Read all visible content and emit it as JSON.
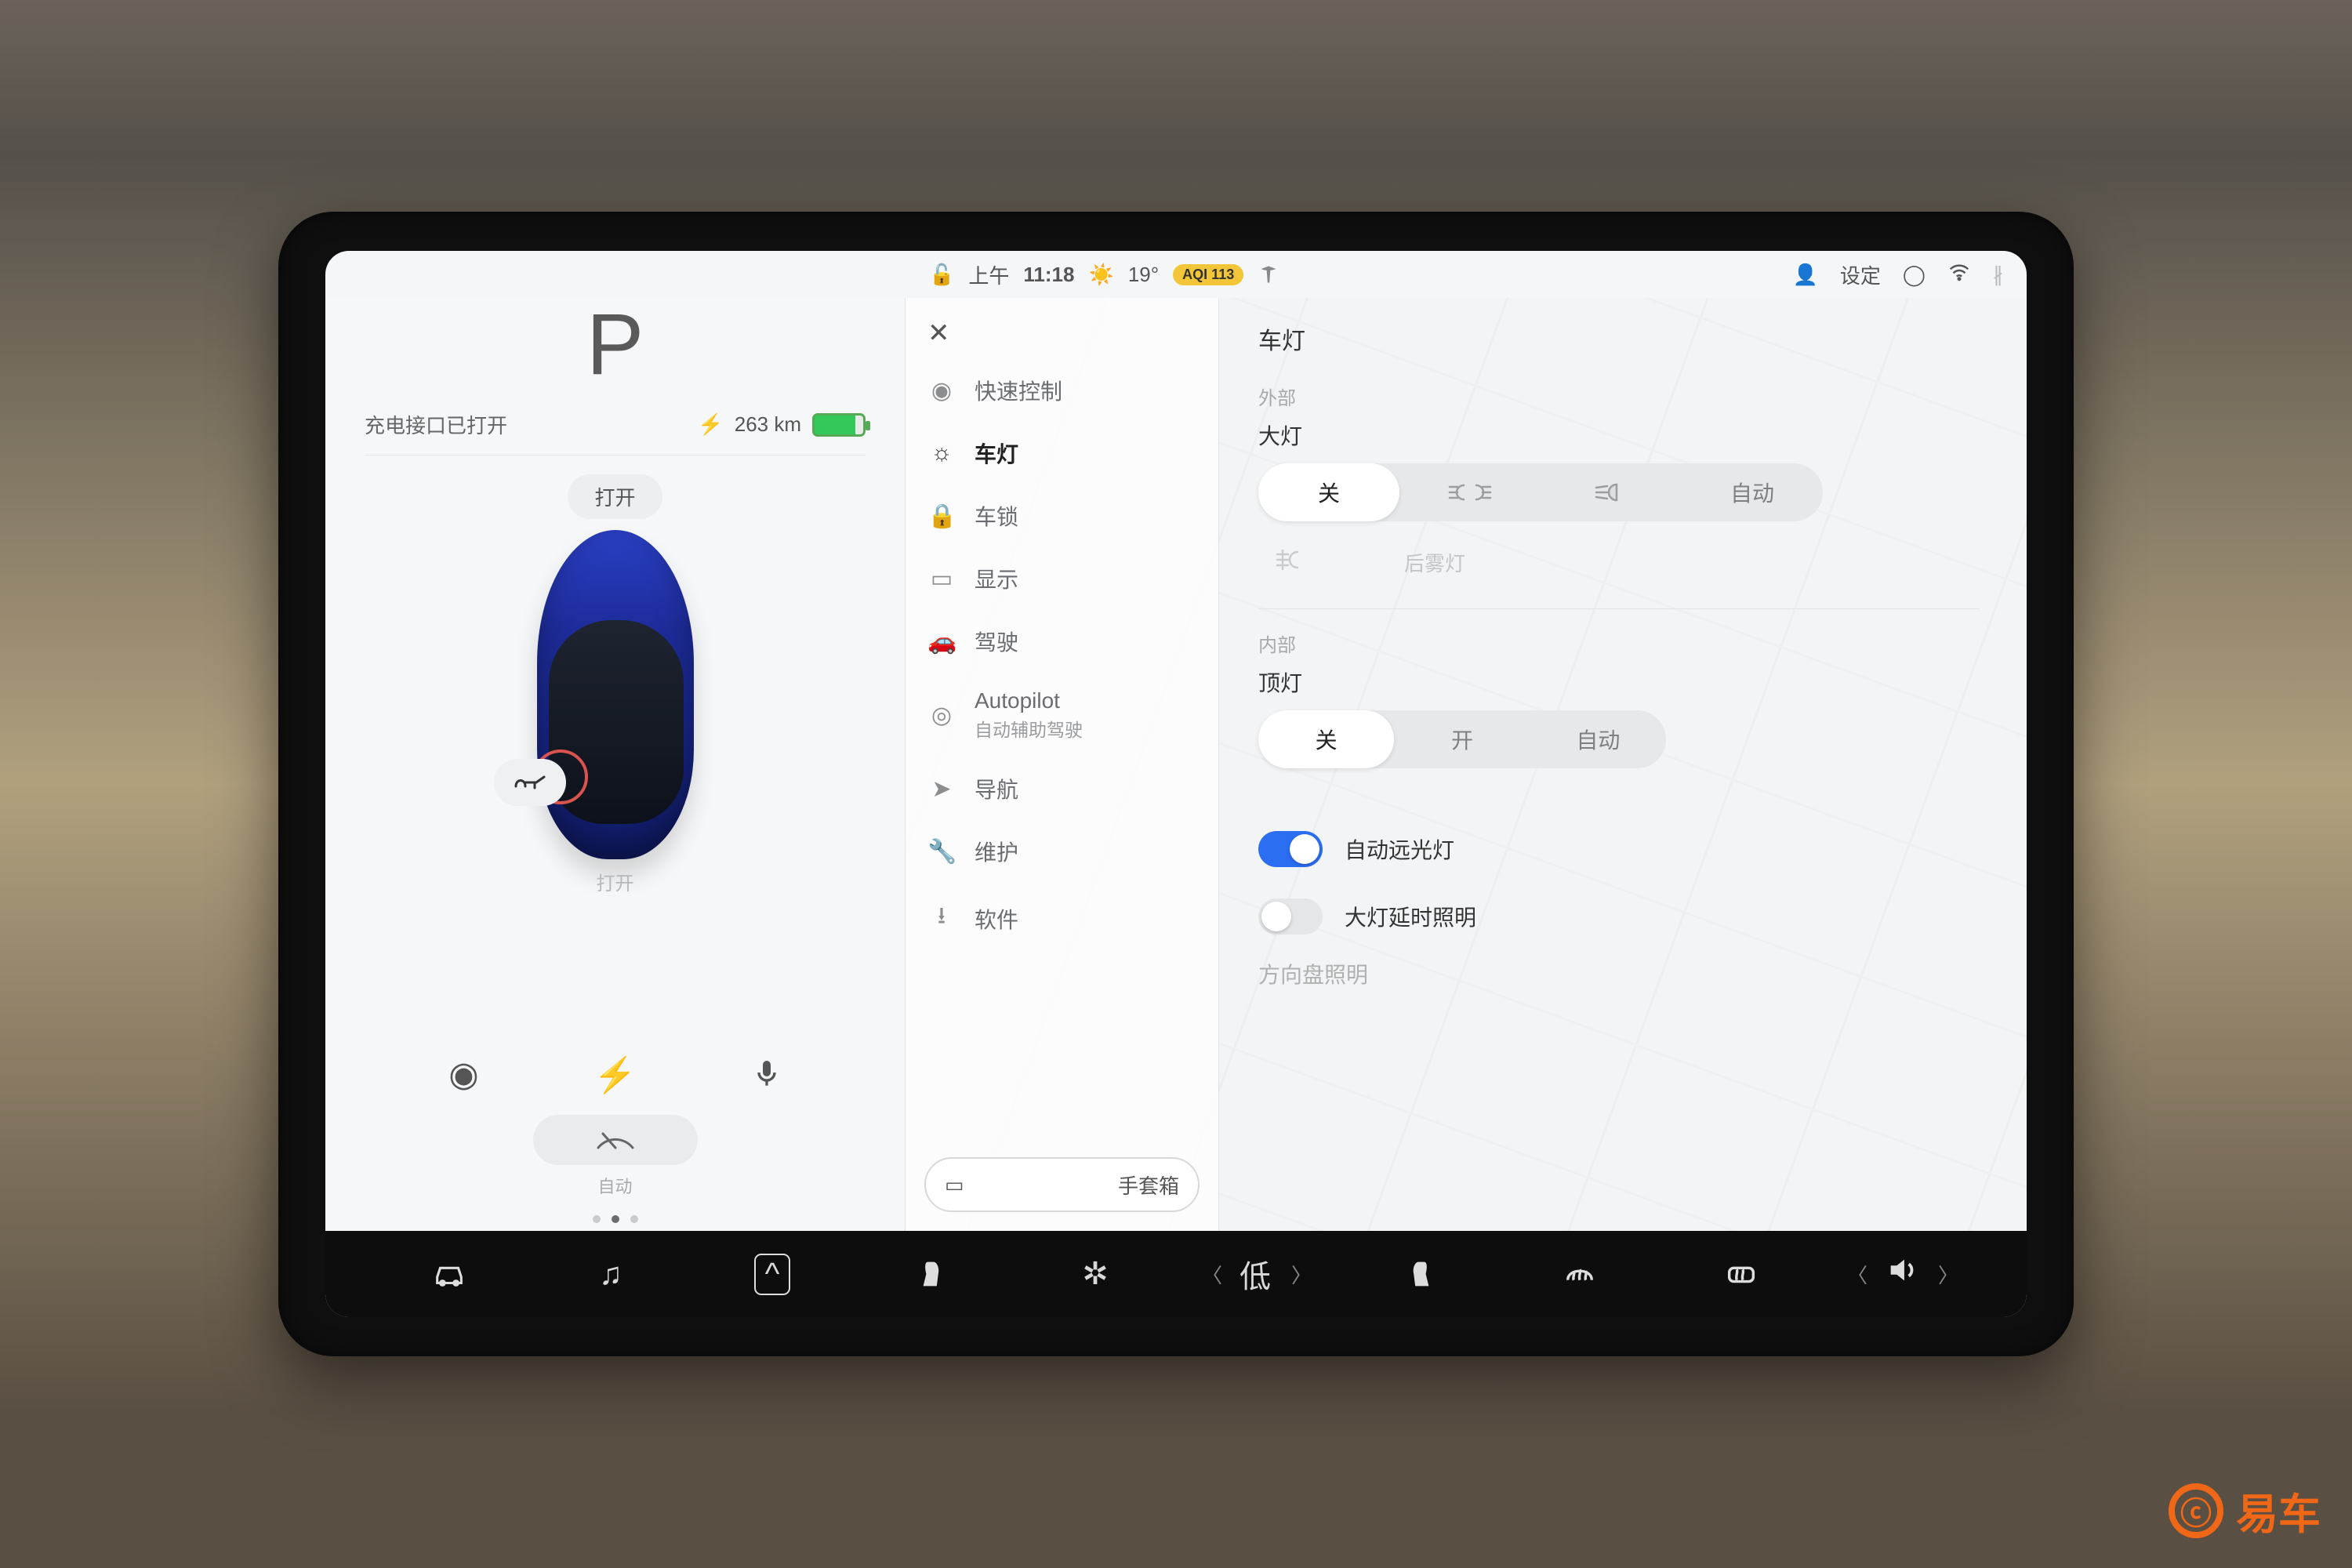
{
  "statusbar": {
    "time_prefix": "上午",
    "time": "11:18",
    "temp": "19°",
    "aqi": "AQI 113",
    "settings_label": "设定"
  },
  "status_panel": {
    "gear": "P",
    "charge_port_msg": "充电接口已打开",
    "range": "263 km",
    "frunk_label": "打开",
    "port_label": "打开",
    "wiper_mode": "自动"
  },
  "menu": {
    "items": [
      {
        "icon": "◉",
        "label": "快速控制"
      },
      {
        "icon": "☼",
        "label": "车灯"
      },
      {
        "icon": "🔒",
        "label": "车锁"
      },
      {
        "icon": "▭",
        "label": "显示"
      },
      {
        "icon": "🚗",
        "label": "驾驶"
      },
      {
        "icon": "◎",
        "label": "Autopilot",
        "sub": "自动辅助驾驶"
      },
      {
        "icon": "➤",
        "label": "导航"
      },
      {
        "icon": "🔧",
        "label": "维护"
      },
      {
        "icon": "⭳",
        "label": "软件"
      }
    ],
    "glovebox": "手套箱"
  },
  "detail": {
    "title": "车灯",
    "exterior_label": "外部",
    "headlights_label": "大灯",
    "headlights_options": [
      "关",
      "ᴅᴏᴅ",
      "≡D",
      "自动"
    ],
    "front_fog_label": "",
    "rear_fog_label": "后雾灯",
    "interior_label": "内部",
    "dome_label": "顶灯",
    "dome_options": [
      "关",
      "开",
      "自动"
    ],
    "auto_high_beam_label": "自动远光灯",
    "headlights_delay_label": "大灯延时照明",
    "truncated_label": "方向盘照明"
  },
  "dock": {
    "temp_label": "低"
  },
  "watermark": "易车"
}
